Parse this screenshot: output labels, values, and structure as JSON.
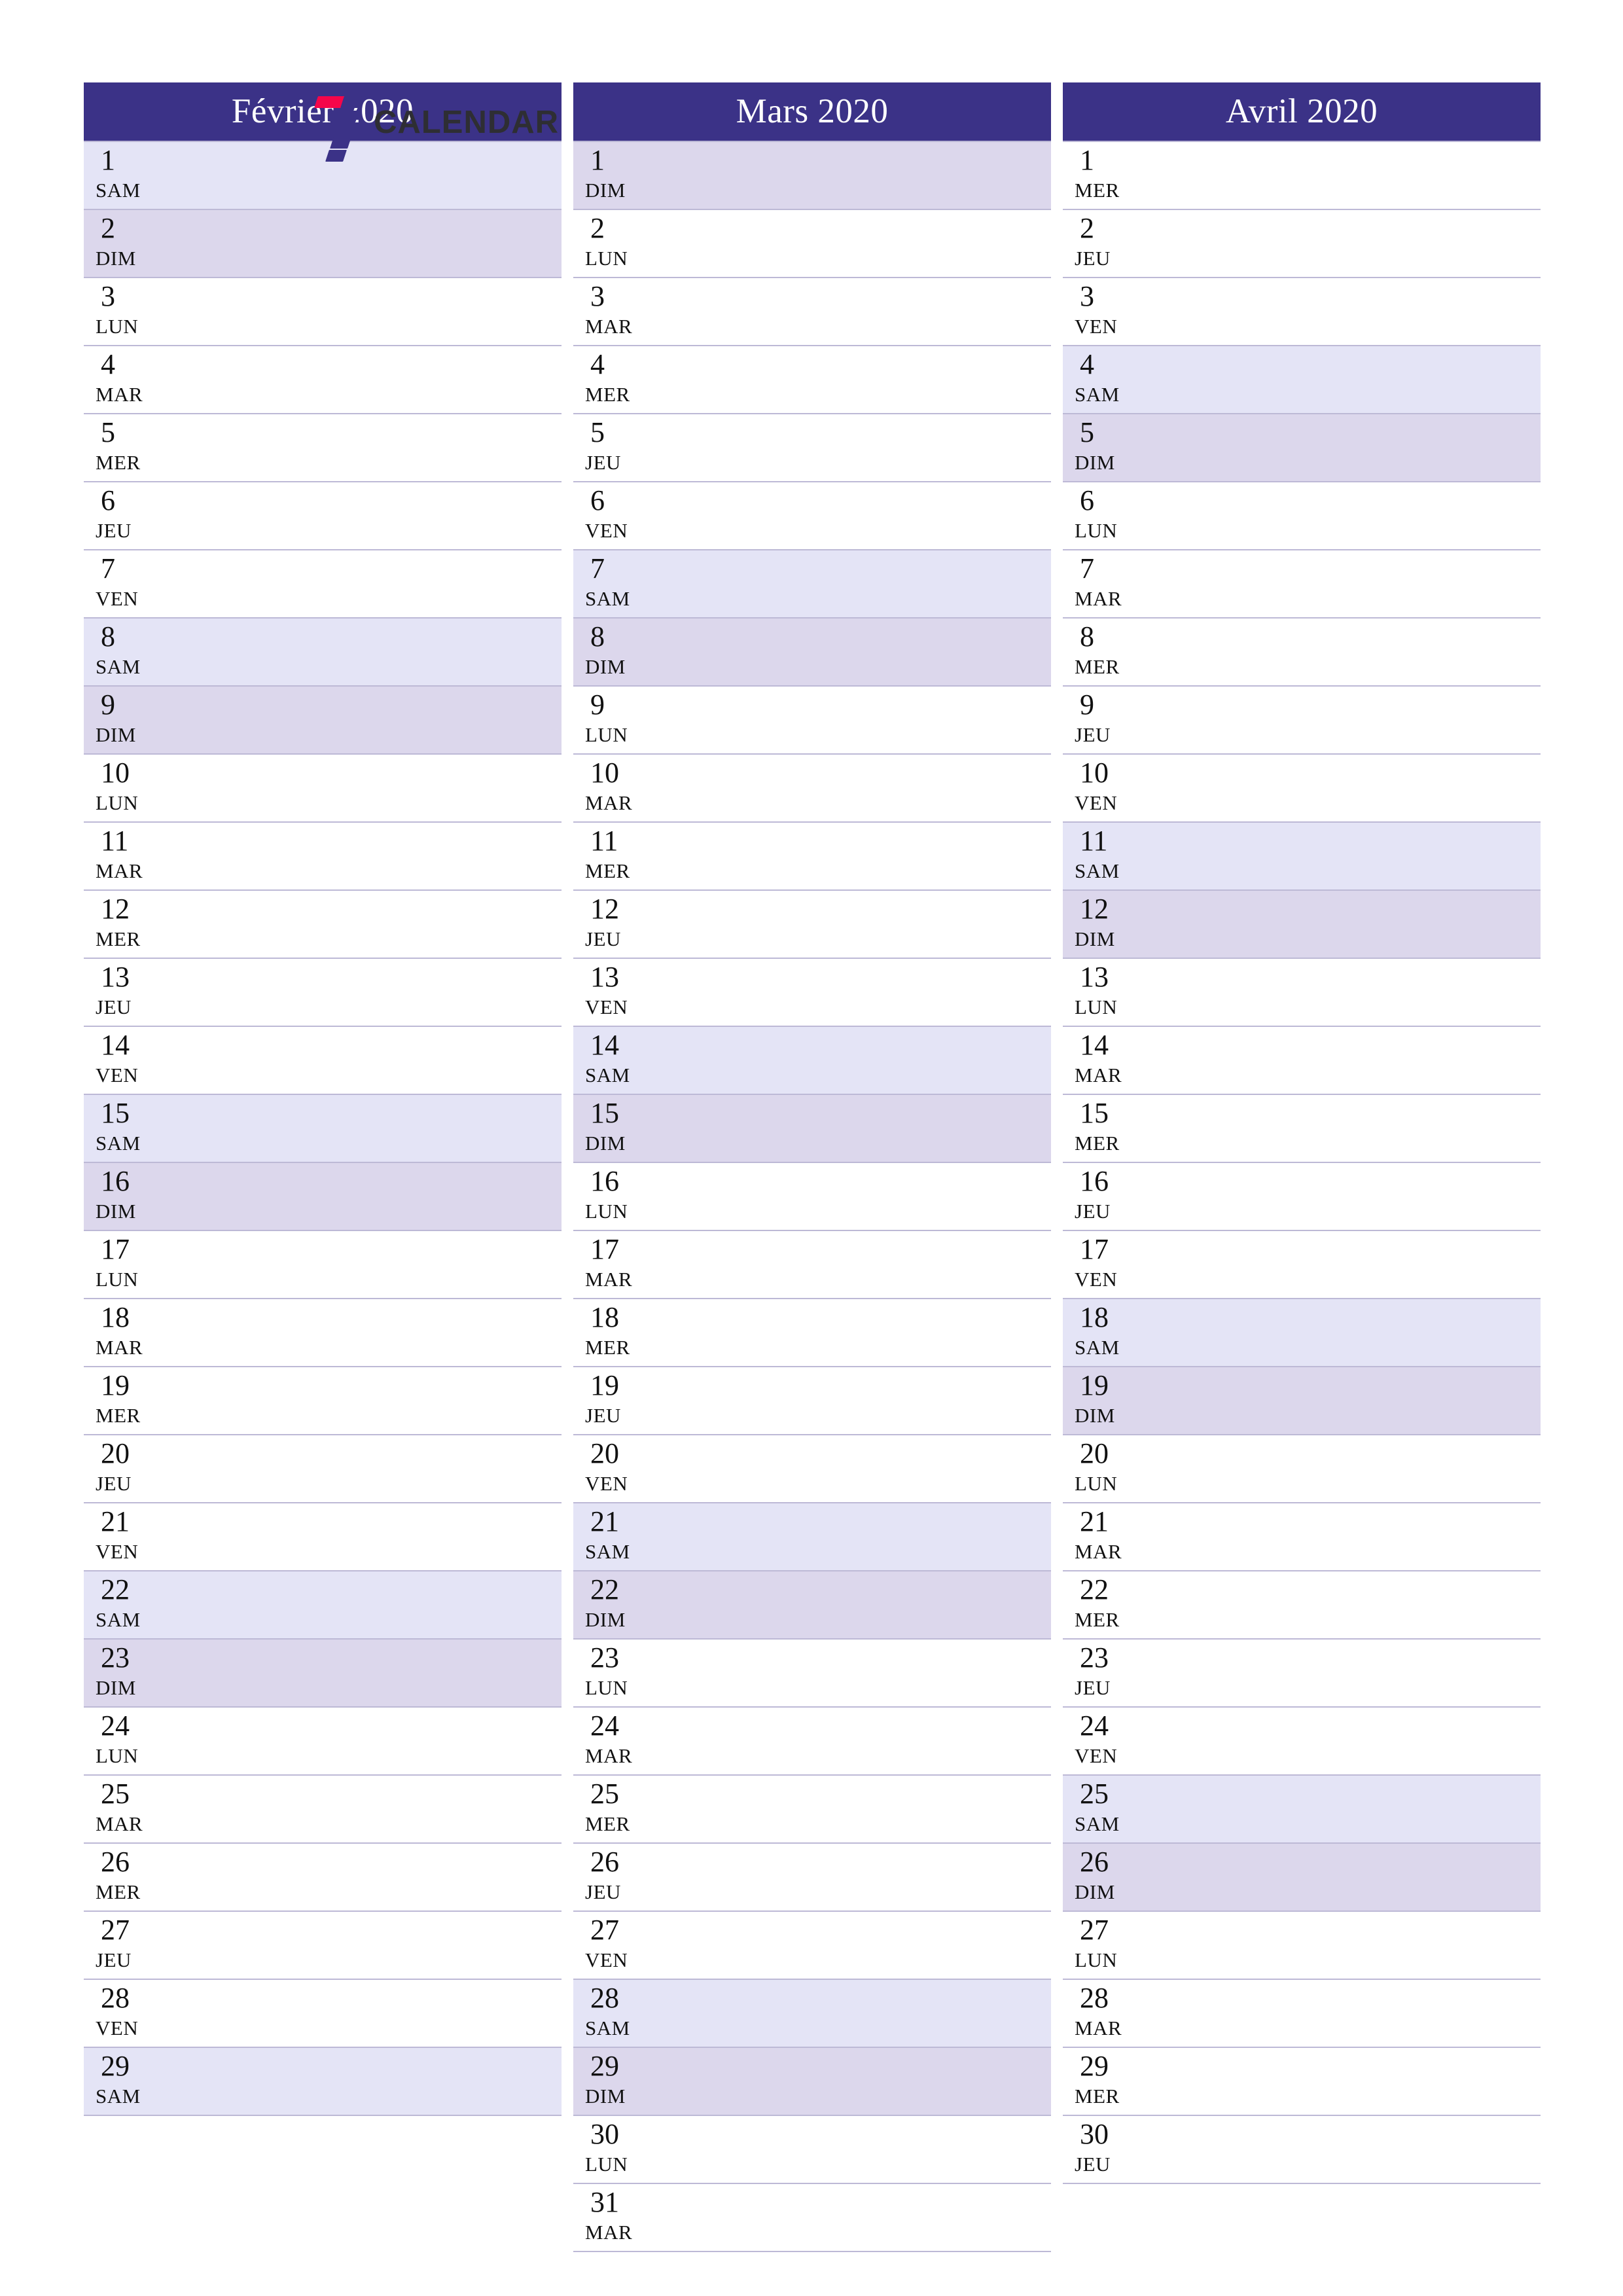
{
  "page": {
    "orientation": "portrait",
    "colors": {
      "header_bg": "#3b3287",
      "header_text": "#ffffff",
      "saturday_bg": "#e4e4f6",
      "sunday_bg": "#dcd7ec",
      "weekday_bg": "#ffffff",
      "row_border": "#bdb9d6",
      "day_text": "#111111",
      "logo_red": "#f5064a",
      "logo_purple": "#3b3287",
      "logo_word": "#2e2e33"
    }
  },
  "brand": {
    "mark_name": "seven-blocks-logo",
    "word": "CALENDAR"
  },
  "months": [
    {
      "title": "Février 2020",
      "name": "fevrier",
      "year": "2020",
      "days": [
        {
          "num": "1",
          "abbr": "SAM",
          "type": "sat"
        },
        {
          "num": "2",
          "abbr": "DIM",
          "type": "sun"
        },
        {
          "num": "3",
          "abbr": "LUN",
          "type": "weekday"
        },
        {
          "num": "4",
          "abbr": "MAR",
          "type": "weekday"
        },
        {
          "num": "5",
          "abbr": "MER",
          "type": "weekday"
        },
        {
          "num": "6",
          "abbr": "JEU",
          "type": "weekday"
        },
        {
          "num": "7",
          "abbr": "VEN",
          "type": "weekday"
        },
        {
          "num": "8",
          "abbr": "SAM",
          "type": "sat"
        },
        {
          "num": "9",
          "abbr": "DIM",
          "type": "sun"
        },
        {
          "num": "10",
          "abbr": "LUN",
          "type": "weekday"
        },
        {
          "num": "11",
          "abbr": "MAR",
          "type": "weekday"
        },
        {
          "num": "12",
          "abbr": "MER",
          "type": "weekday"
        },
        {
          "num": "13",
          "abbr": "JEU",
          "type": "weekday"
        },
        {
          "num": "14",
          "abbr": "VEN",
          "type": "weekday"
        },
        {
          "num": "15",
          "abbr": "SAM",
          "type": "sat"
        },
        {
          "num": "16",
          "abbr": "DIM",
          "type": "sun"
        },
        {
          "num": "17",
          "abbr": "LUN",
          "type": "weekday"
        },
        {
          "num": "18",
          "abbr": "MAR",
          "type": "weekday"
        },
        {
          "num": "19",
          "abbr": "MER",
          "type": "weekday"
        },
        {
          "num": "20",
          "abbr": "JEU",
          "type": "weekday"
        },
        {
          "num": "21",
          "abbr": "VEN",
          "type": "weekday"
        },
        {
          "num": "22",
          "abbr": "SAM",
          "type": "sat"
        },
        {
          "num": "23",
          "abbr": "DIM",
          "type": "sun"
        },
        {
          "num": "24",
          "abbr": "LUN",
          "type": "weekday"
        },
        {
          "num": "25",
          "abbr": "MAR",
          "type": "weekday"
        },
        {
          "num": "26",
          "abbr": "MER",
          "type": "weekday"
        },
        {
          "num": "27",
          "abbr": "JEU",
          "type": "weekday"
        },
        {
          "num": "28",
          "abbr": "VEN",
          "type": "weekday"
        },
        {
          "num": "29",
          "abbr": "SAM",
          "type": "sat"
        }
      ]
    },
    {
      "title": "Mars 2020",
      "name": "mars",
      "year": "2020",
      "days": [
        {
          "num": "1",
          "abbr": "DIM",
          "type": "sun"
        },
        {
          "num": "2",
          "abbr": "LUN",
          "type": "weekday"
        },
        {
          "num": "3",
          "abbr": "MAR",
          "type": "weekday"
        },
        {
          "num": "4",
          "abbr": "MER",
          "type": "weekday"
        },
        {
          "num": "5",
          "abbr": "JEU",
          "type": "weekday"
        },
        {
          "num": "6",
          "abbr": "VEN",
          "type": "weekday"
        },
        {
          "num": "7",
          "abbr": "SAM",
          "type": "sat"
        },
        {
          "num": "8",
          "abbr": "DIM",
          "type": "sun"
        },
        {
          "num": "9",
          "abbr": "LUN",
          "type": "weekday"
        },
        {
          "num": "10",
          "abbr": "MAR",
          "type": "weekday"
        },
        {
          "num": "11",
          "abbr": "MER",
          "type": "weekday"
        },
        {
          "num": "12",
          "abbr": "JEU",
          "type": "weekday"
        },
        {
          "num": "13",
          "abbr": "VEN",
          "type": "weekday"
        },
        {
          "num": "14",
          "abbr": "SAM",
          "type": "sat"
        },
        {
          "num": "15",
          "abbr": "DIM",
          "type": "sun"
        },
        {
          "num": "16",
          "abbr": "LUN",
          "type": "weekday"
        },
        {
          "num": "17",
          "abbr": "MAR",
          "type": "weekday"
        },
        {
          "num": "18",
          "abbr": "MER",
          "type": "weekday"
        },
        {
          "num": "19",
          "abbr": "JEU",
          "type": "weekday"
        },
        {
          "num": "20",
          "abbr": "VEN",
          "type": "weekday"
        },
        {
          "num": "21",
          "abbr": "SAM",
          "type": "sat"
        },
        {
          "num": "22",
          "abbr": "DIM",
          "type": "sun"
        },
        {
          "num": "23",
          "abbr": "LUN",
          "type": "weekday"
        },
        {
          "num": "24",
          "abbr": "MAR",
          "type": "weekday"
        },
        {
          "num": "25",
          "abbr": "MER",
          "type": "weekday"
        },
        {
          "num": "26",
          "abbr": "JEU",
          "type": "weekday"
        },
        {
          "num": "27",
          "abbr": "VEN",
          "type": "weekday"
        },
        {
          "num": "28",
          "abbr": "SAM",
          "type": "sat"
        },
        {
          "num": "29",
          "abbr": "DIM",
          "type": "sun"
        },
        {
          "num": "30",
          "abbr": "LUN",
          "type": "weekday"
        },
        {
          "num": "31",
          "abbr": "MAR",
          "type": "weekday"
        }
      ]
    },
    {
      "title": "Avril 2020",
      "name": "avril",
      "year": "2020",
      "days": [
        {
          "num": "1",
          "abbr": "MER",
          "type": "weekday"
        },
        {
          "num": "2",
          "abbr": "JEU",
          "type": "weekday"
        },
        {
          "num": "3",
          "abbr": "VEN",
          "type": "weekday"
        },
        {
          "num": "4",
          "abbr": "SAM",
          "type": "sat"
        },
        {
          "num": "5",
          "abbr": "DIM",
          "type": "sun"
        },
        {
          "num": "6",
          "abbr": "LUN",
          "type": "weekday"
        },
        {
          "num": "7",
          "abbr": "MAR",
          "type": "weekday"
        },
        {
          "num": "8",
          "abbr": "MER",
          "type": "weekday"
        },
        {
          "num": "9",
          "abbr": "JEU",
          "type": "weekday"
        },
        {
          "num": "10",
          "abbr": "VEN",
          "type": "weekday"
        },
        {
          "num": "11",
          "abbr": "SAM",
          "type": "sat"
        },
        {
          "num": "12",
          "abbr": "DIM",
          "type": "sun"
        },
        {
          "num": "13",
          "abbr": "LUN",
          "type": "weekday"
        },
        {
          "num": "14",
          "abbr": "MAR",
          "type": "weekday"
        },
        {
          "num": "15",
          "abbr": "MER",
          "type": "weekday"
        },
        {
          "num": "16",
          "abbr": "JEU",
          "type": "weekday"
        },
        {
          "num": "17",
          "abbr": "VEN",
          "type": "weekday"
        },
        {
          "num": "18",
          "abbr": "SAM",
          "type": "sat"
        },
        {
          "num": "19",
          "abbr": "DIM",
          "type": "sun"
        },
        {
          "num": "20",
          "abbr": "LUN",
          "type": "weekday"
        },
        {
          "num": "21",
          "abbr": "MAR",
          "type": "weekday"
        },
        {
          "num": "22",
          "abbr": "MER",
          "type": "weekday"
        },
        {
          "num": "23",
          "abbr": "JEU",
          "type": "weekday"
        },
        {
          "num": "24",
          "abbr": "VEN",
          "type": "weekday"
        },
        {
          "num": "25",
          "abbr": "SAM",
          "type": "sat"
        },
        {
          "num": "26",
          "abbr": "DIM",
          "type": "sun"
        },
        {
          "num": "27",
          "abbr": "LUN",
          "type": "weekday"
        },
        {
          "num": "28",
          "abbr": "MAR",
          "type": "weekday"
        },
        {
          "num": "29",
          "abbr": "MER",
          "type": "weekday"
        },
        {
          "num": "30",
          "abbr": "JEU",
          "type": "weekday"
        }
      ]
    }
  ]
}
